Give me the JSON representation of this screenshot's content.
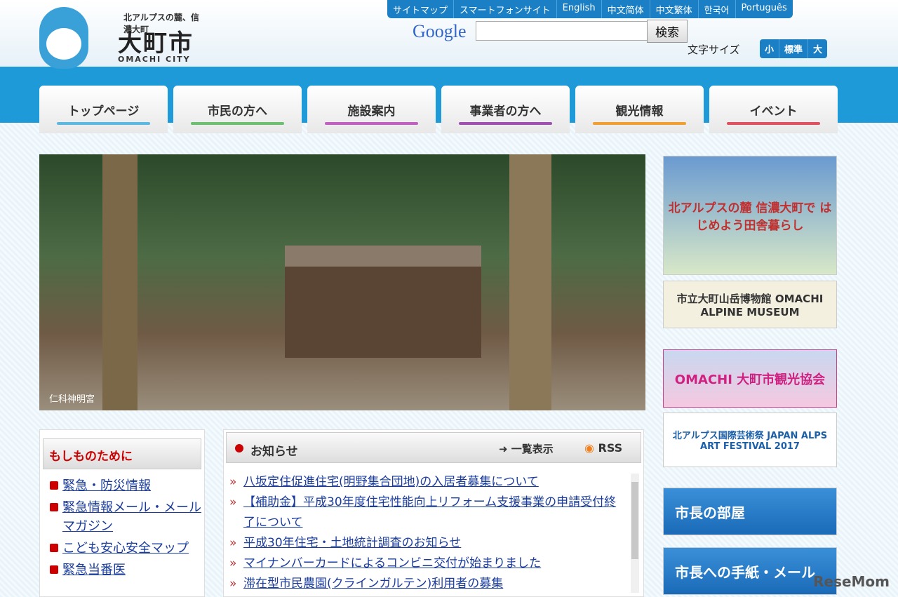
{
  "header": {
    "tagline": "北アルプスの麓、信濃大町",
    "city": "大町市",
    "city_en": "OMACHI CITY",
    "languages": [
      "サイトマップ",
      "スマートフォンサイト",
      "English",
      "中文简体",
      "中文繁体",
      "한국어",
      "Português"
    ],
    "google": "Google",
    "search_button": "検索",
    "font_size_label": "文字サイズ",
    "font_sizes": [
      "小",
      "標準",
      "大"
    ]
  },
  "nav": [
    {
      "label": "トップページ",
      "color": "#5bb8e0"
    },
    {
      "label": "市民の方へ",
      "color": "#6cc070"
    },
    {
      "label": "施設案内",
      "color": "#c060c0"
    },
    {
      "label": "事業者の方へ",
      "color": "#a050b0"
    },
    {
      "label": "観光情報",
      "color": "#f0a030"
    },
    {
      "label": "イベント",
      "color": "#e05060"
    }
  ],
  "hero": {
    "caption": "仁科神明宮"
  },
  "banners": [
    "北アルプスの麓 信濃大町で はじめよう田舎暮らし",
    "市立大町山岳博物館 OMACHI ALPINE MUSEUM",
    "OMACHI 大町市観光協会",
    "北アルプス国際芸術祭 JAPAN ALPS ART FESTIVAL 2017",
    "市長の部屋",
    "市長への手紙・メール"
  ],
  "emergency": {
    "title": "もしものために",
    "items": [
      "緊急・防災情報",
      "緊急情報メール・メールマガジン",
      "こども安心安全マップ",
      "緊急当番医"
    ]
  },
  "notice": {
    "title": "お知らせ",
    "list_label": "一覧表示",
    "rss_label": "RSS",
    "items": [
      "八坂定住促進住宅(明野集合団地)の入居者募集について",
      "【補助金】平成30年度住宅性能向上リフォーム支援事業の申請受付終了について",
      "平成30年住宅・土地統計調査のお知らせ",
      "マイナンバーカードによるコンビニ交付が始まりました",
      "滞在型市民農園(クラインガルテン)利用者の募集"
    ]
  },
  "watermark": "ReseMom"
}
